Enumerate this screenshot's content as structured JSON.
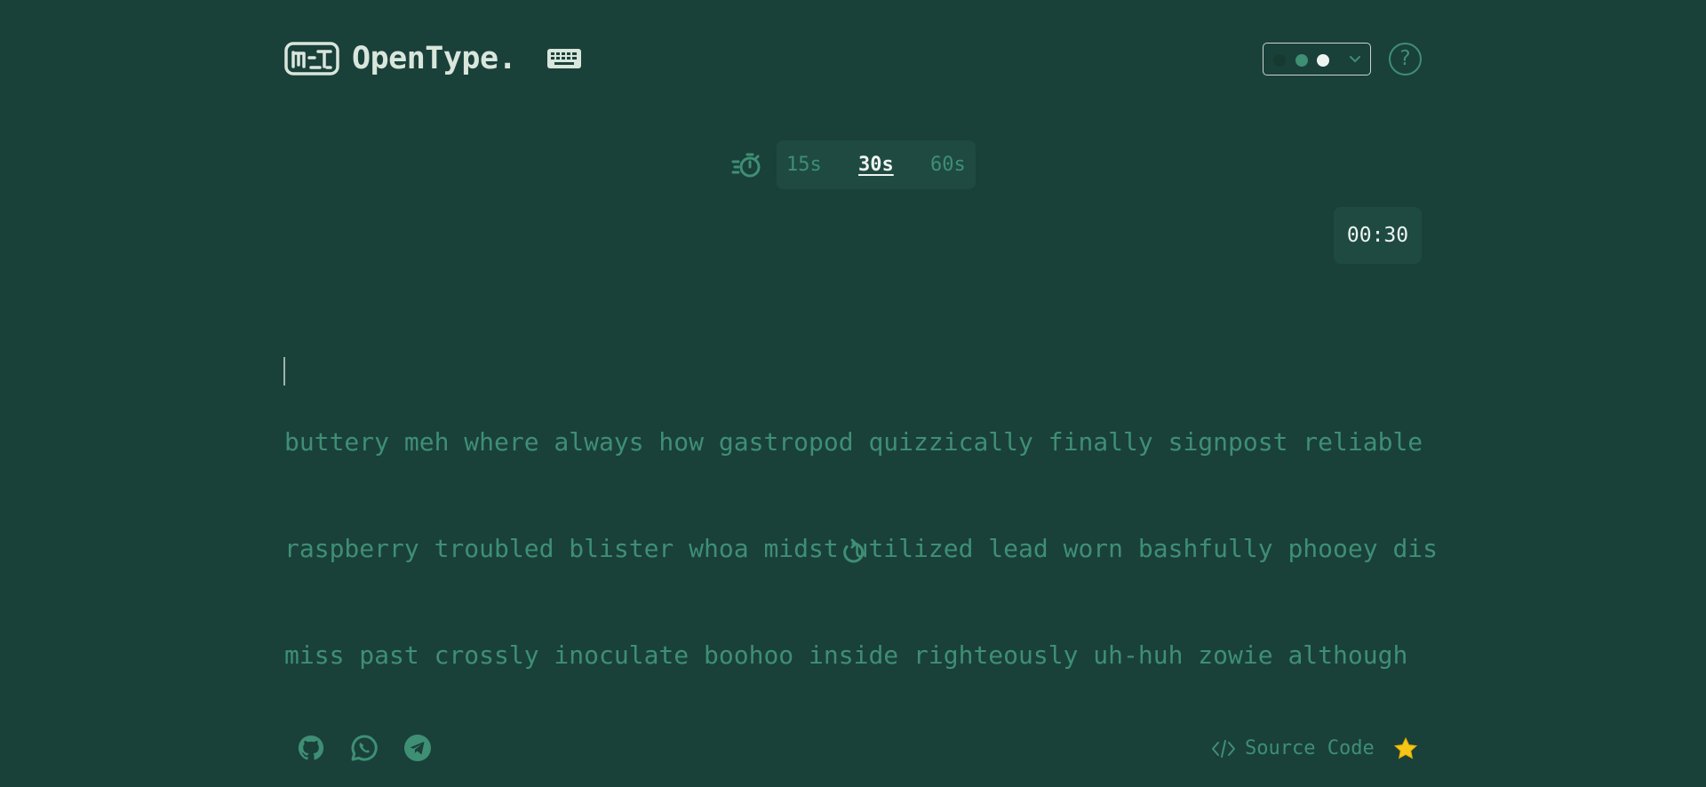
{
  "header": {
    "app_name": "OpenType.",
    "logo_icon": "keyboard-logo-icon",
    "keyboard_icon": "keyboard-icon",
    "theme_picker": {
      "icon": "chevron-down-icon",
      "swatches": [
        "#1a3a32",
        "#3e8f74",
        "#eef5f0"
      ]
    },
    "help_label": "?"
  },
  "test_config": {
    "icon": "stopwatch-icon",
    "durations": [
      "15s",
      "30s",
      "60s"
    ],
    "selected": "30s"
  },
  "timer": {
    "value": "00:30"
  },
  "words": {
    "lines": [
      "buttery meh where always how gastropod quizzically finally signpost reliable",
      "raspberry troubled blister whoa midst utilized lead worn bashfully phooey dis",
      "miss past crossly inoculate boohoo inside righteously uh-huh zowie although"
    ]
  },
  "restart": {
    "icon": "restart-icon"
  },
  "footer": {
    "social_icons": [
      "github-icon",
      "whatsapp-icon",
      "telegram-icon"
    ],
    "source_label": "Source Code",
    "source_icon": "code-icon",
    "star_icon": "star-icon"
  },
  "colors": {
    "background": "#1a403a",
    "panel": "#1f4a42",
    "accent": "#3e8f74",
    "text": "#eef5f0",
    "star": "#f5c518"
  }
}
